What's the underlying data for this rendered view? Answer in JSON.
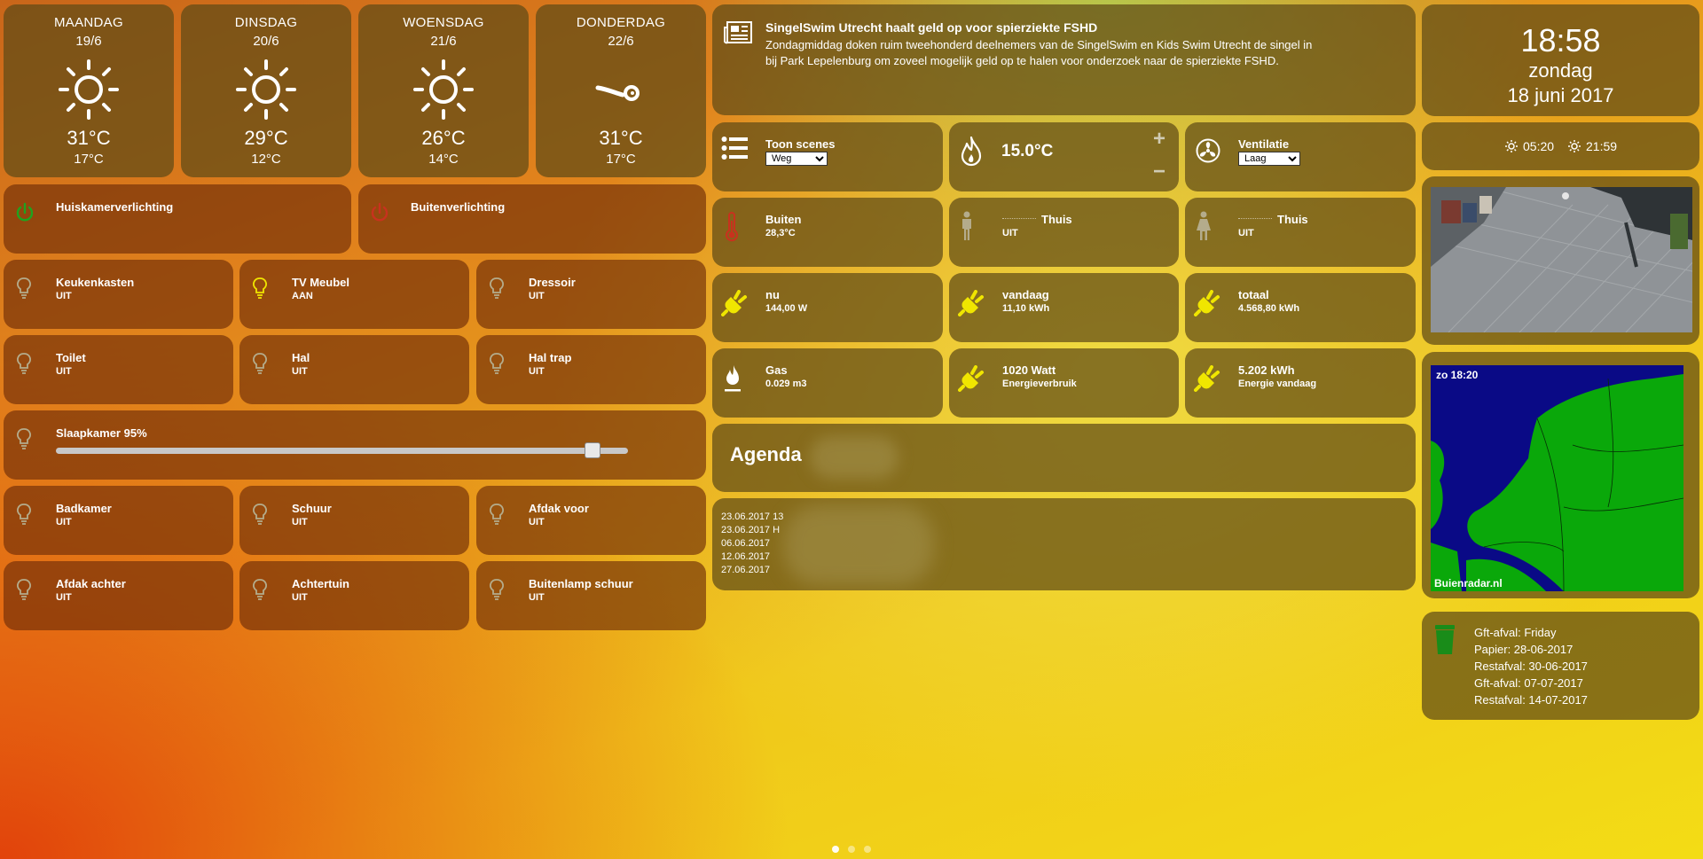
{
  "weather": [
    {
      "day": "MAANDAG",
      "date": "19/6",
      "high": "31°C",
      "low": "17°C",
      "icon": "sun-icon"
    },
    {
      "day": "DINSDAG",
      "date": "20/6",
      "high": "29°C",
      "low": "12°C",
      "icon": "sun-icon"
    },
    {
      "day": "WOENSDAG",
      "date": "21/6",
      "high": "26°C",
      "low": "14°C",
      "icon": "sun-icon"
    },
    {
      "day": "DONDERDAG",
      "date": "22/6",
      "high": "31°C",
      "low": "17°C",
      "icon": "wind-icon"
    }
  ],
  "news": {
    "title": "SingelSwim Utrecht haalt geld op voor spierziekte FSHD",
    "line1": "Zondagmiddag doken ruim tweehonderd deelnemers van de SingelSwim en Kids Swim Utrecht de singel in",
    "line2": "bij Park Lepelenburg om zoveel mogelijk geld op te halen voor onderzoek naar de spierziekte FSHD."
  },
  "clock": {
    "time": "18:58",
    "weekday": "zondag",
    "date": "18 juni 2017"
  },
  "sun": {
    "rise": "05:20",
    "set": "21:59"
  },
  "groups": [
    {
      "label": "Huiskamerverlichting",
      "color": "#1fa31f"
    },
    {
      "label": "Buitenverlichting",
      "color": "#c8321e"
    }
  ],
  "lights": [
    {
      "name": "Keukenkasten",
      "state": "UIT",
      "on": false
    },
    {
      "name": "TV Meubel",
      "state": "AAN",
      "on": true
    },
    {
      "name": "Dressoir",
      "state": "UIT",
      "on": false
    },
    {
      "name": "Toilet",
      "state": "UIT",
      "on": false
    },
    {
      "name": "Hal",
      "state": "UIT",
      "on": false
    },
    {
      "name": "Hal trap",
      "state": "UIT",
      "on": false
    },
    {
      "name": "Badkamer",
      "state": "UIT",
      "on": false
    },
    {
      "name": "Schuur",
      "state": "UIT",
      "on": false
    },
    {
      "name": "Afdak voor",
      "state": "UIT",
      "on": false
    },
    {
      "name": "Afdak achter",
      "state": "UIT",
      "on": false
    },
    {
      "name": "Achtertuin",
      "state": "UIT",
      "on": false
    },
    {
      "name": "Buitenlamp schuur",
      "state": "UIT",
      "on": false
    }
  ],
  "dimmer": {
    "label": "Slaapkamer 95%",
    "value": 95
  },
  "scenes": {
    "label": "Toon scenes",
    "selected": "Weg"
  },
  "thermostat": {
    "setpoint": "15.0°C",
    "plus": "+",
    "minus": "−"
  },
  "ventilation": {
    "label": "Ventilatie",
    "selected": "Laag"
  },
  "outside": {
    "label": "Buiten",
    "value": "28,3°C"
  },
  "presence": [
    {
      "name": "Thuis",
      "state": "UIT"
    },
    {
      "name": "Thuis",
      "state": "UIT"
    }
  ],
  "energy": [
    {
      "label": "nu",
      "value": "144,00 W",
      "icon": "plug-icon"
    },
    {
      "label": "vandaag",
      "value": "11,10 kWh",
      "icon": "plug-icon"
    },
    {
      "label": "totaal",
      "value": "4.568,80 kWh",
      "icon": "plug-icon"
    },
    {
      "label": "Gas",
      "value": "0.029 m3",
      "icon": "gas-icon"
    },
    {
      "label": "1020 Watt",
      "value": "Energieverbruik",
      "icon": "plug-icon"
    },
    {
      "label": "5.202 kWh",
      "value": "Energie vandaag",
      "icon": "plug-icon"
    }
  ],
  "agenda": {
    "title": "Agenda",
    "items": [
      "23.06.2017 13",
      "23.06.2017 H",
      "06.06.2017 ",
      "12.06.2017",
      "27.06.2017 "
    ]
  },
  "radar": {
    "time": "zo 18:20",
    "credit": "Buienradar.nl"
  },
  "waste": [
    "Gft-afval: Friday",
    "Papier: 28-06-2017",
    "Restafval: 30-06-2017",
    "Gft-afval: 07-07-2017",
    "Restafval: 14-07-2017"
  ],
  "colors": {
    "tile": "#5f4b16",
    "on": "#f0e600",
    "off": "#b4ac8c",
    "plug": "#f0e600"
  }
}
